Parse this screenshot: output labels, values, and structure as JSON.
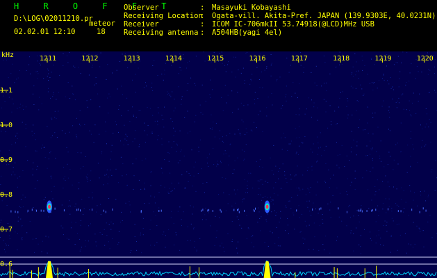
{
  "header": {
    "title": "H R O F F T",
    "log_file": "D:\\LOG\\02011210.pr",
    "meteor_label": "meteor",
    "datetime": "02.02.01 12:10",
    "count": "18",
    "fields": [
      {
        "label": "Observer",
        "value": "Masayuki Kobayashi"
      },
      {
        "label": "Receiving Location",
        "value": "Ogata-vill. Akita-Pref. JAPAN (139.9303E, 40.0231N)"
      },
      {
        "label": "Receiver",
        "value": "ICOM IC-706mkII 53.74918(@LCD)MHz USB"
      },
      {
        "label": "Receiving antenna",
        "value": "A504HB(yagi 4el)"
      }
    ]
  },
  "plot": {
    "y_unit": "kHz",
    "x_ticks": [
      "1211",
      "1212",
      "1213",
      "1214",
      "1215",
      "1216",
      "1217",
      "1218",
      "1219",
      "1220"
    ],
    "y_ticks": [
      "1.1",
      "1.0",
      "0.9",
      "0.8",
      "0.7",
      "0.6"
    ],
    "background_color": "#02004a",
    "tick_color": "#ffff00",
    "meteor_echoes": [
      {
        "x": 1211.05,
        "y": 0.765
      },
      {
        "x": 1216.25,
        "y": 0.765
      }
    ]
  }
}
